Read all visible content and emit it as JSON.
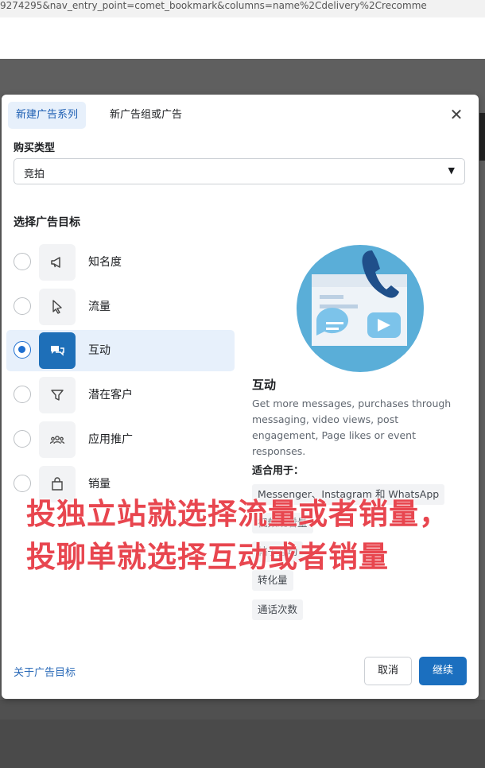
{
  "browser": {
    "url_fragment": "9274295&nav_entry_point=comet_bookmark&columns=name%2Cdelivery%2Crecomme"
  },
  "modal": {
    "tabs": [
      {
        "label": "新建广告系列",
        "active": true
      },
      {
        "label": "新广告组或广告",
        "active": false
      }
    ],
    "close_icon": "close-icon",
    "buy_type": {
      "label": "购买类型",
      "value": "竞拍"
    },
    "objective_title": "选择广告目标",
    "options": [
      {
        "label": "知名度",
        "icon": "megaphone-icon",
        "selected": false
      },
      {
        "label": "流量",
        "icon": "cursor-icon",
        "selected": false
      },
      {
        "label": "互动",
        "icon": "chat-bubbles-icon",
        "selected": true
      },
      {
        "label": "潜在客户",
        "icon": "filter-icon",
        "selected": false
      },
      {
        "label": "应用推广",
        "icon": "people-icon",
        "selected": false
      },
      {
        "label": "销量",
        "icon": "shopping-bag-icon",
        "selected": false
      }
    ],
    "detail": {
      "title": "互动",
      "description": "Get more messages, purchases through messaging, video views, post engagement, Page likes or event responses.",
      "suitable_label": "适合用于：",
      "chips": [
        "Messenger、Instagram 和 WhatsApp",
        "视频观看量",
        "帖子互动",
        "转化量",
        "通话次数"
      ]
    },
    "footer": {
      "link": "关于广告目标",
      "cancel": "取消",
      "continue": "继续"
    }
  },
  "overlay_text": "投独立站就选择流量或者销量，投聊单就选择互动或者销量",
  "colors": {
    "accent": "#1b6fbf",
    "overlay": "#e8464f",
    "selected_bg": "#e7f0fb"
  }
}
